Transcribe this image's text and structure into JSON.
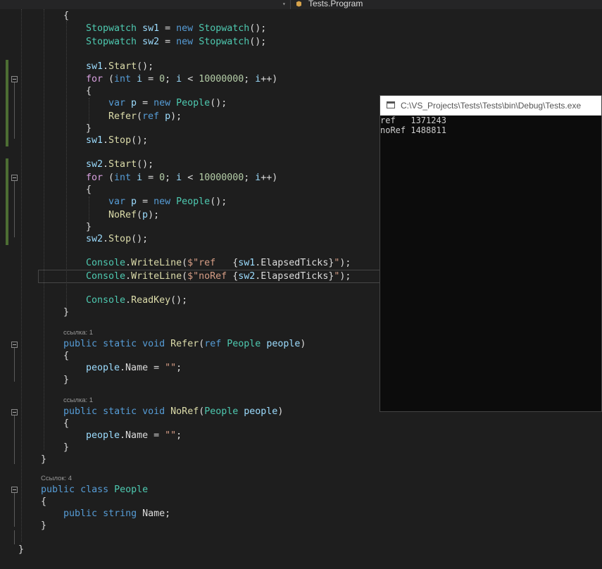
{
  "toolbar": {
    "dropdown_arrow": "▾",
    "class_label": "Tests.Program"
  },
  "code": {
    "lines": [
      "{",
      "Stopwatch sw1 = new Stopwatch();",
      "Stopwatch sw2 = new Stopwatch();",
      "sw1.Start();",
      "for (int i = 0; i < 10000000; i++)",
      "{",
      "var p = new People();",
      "Refer(ref p);",
      "}",
      "sw1.Stop();",
      "sw2.Start();",
      "for (int i = 0; i < 10000000; i++)",
      "{",
      "var p = new People();",
      "NoRef(p);",
      "}",
      "sw2.Stop();",
      "Console.WriteLine($\"ref   {sw1.ElapsedTicks}\");",
      "Console.WriteLine($\"noRef {sw2.ElapsedTicks}\");",
      "Console.ReadKey();",
      "}",
      "public static void Refer(ref People people)",
      "{",
      "people.Name = \"\";",
      "}",
      "public static void NoRef(People people)",
      "{",
      "people.Name = \"\";",
      "}",
      "}",
      "public class People",
      "{",
      "public string Name;",
      "}",
      "}"
    ],
    "codelens": [
      "ссылка: 1",
      "ссылка: 1",
      "Ссылок: 4"
    ]
  },
  "console": {
    "title": "C:\\VS_Projects\\Tests\\Tests\\bin\\Debug\\Tests.exe",
    "lines": [
      "ref   1371243",
      "noRef 1488811"
    ]
  },
  "colors": {
    "editor_background": "#1e1e1e",
    "keyword": "#569cd6",
    "type": "#4ec9b0",
    "variable": "#9cdcfe",
    "method": "#dcdcaa",
    "string": "#d69d85",
    "number": "#b5cea8",
    "control": "#d8a0df",
    "change_bar": "#4d6e33",
    "console_background": "#0c0c0c"
  },
  "icons": [
    "dropdown-arrow-icon",
    "class-icon",
    "console-app-icon",
    "collapse-icon"
  ]
}
